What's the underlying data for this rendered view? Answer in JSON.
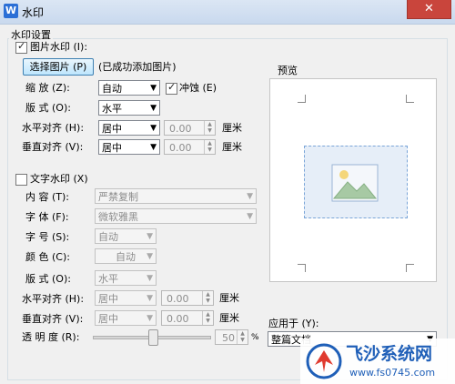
{
  "window": {
    "title": "水印",
    "app_icon": "W",
    "close": "✕"
  },
  "group": {
    "title": "水印设置"
  },
  "picture": {
    "checkbox_label": "图片水印 (I):",
    "checked": true,
    "select_button": "选择图片 (P)",
    "status": "(已成功添加图片)",
    "scale_label": "缩    放 (Z):",
    "scale_value": "自动",
    "erode_label": "冲蚀 (E)",
    "erode_checked": true,
    "layout_label": "版    式 (O):",
    "layout_value": "水平",
    "halign_label": "水平对齐 (H):",
    "halign_value": "居中",
    "halign_num": "0.00",
    "valign_label": "垂直对齐 (V):",
    "valign_value": "居中",
    "valign_num": "0.00",
    "unit": "厘米"
  },
  "text": {
    "checkbox_label": "文字水印 (X)",
    "checked": false,
    "content_label": "内    容 (T):",
    "content_value": "严禁复制",
    "font_label": "字    体 (F):",
    "font_value": "微软雅黑",
    "size_label": "字    号 (S):",
    "size_value": "自动",
    "color_label": "颜    色 (C):",
    "color_value": "自动",
    "layout_label": "版    式 (O):",
    "layout_value": "水平",
    "halign_label": "水平对齐 (H):",
    "halign_value": "居中",
    "halign_num": "0.00",
    "valign_label": "垂直对齐 (V):",
    "valign_value": "居中",
    "valign_num": "0.00",
    "opacity_label": "透 明 度 (R):",
    "opacity_value": "50",
    "opacity_unit": "%",
    "unit": "厘米"
  },
  "preview": {
    "label": "预览"
  },
  "apply": {
    "label": "应用于 (Y):",
    "value": "整篇文档"
  },
  "site_watermark": {
    "name": "飞沙系统网",
    "url": "www.fs0745.com"
  },
  "colors": {
    "titlebar": "#c9d9ee",
    "close": "#c9453c",
    "accent": "#3c7fb1",
    "logo_blue": "#1f5fb8"
  }
}
